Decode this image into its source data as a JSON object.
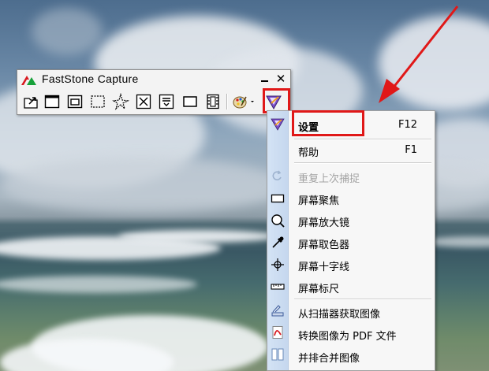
{
  "window": {
    "title": "FastStone Capture",
    "minimize_label": "",
    "close_label": "✕"
  },
  "toolbar": {
    "tools": [
      {
        "name": "open-file-icon"
      },
      {
        "name": "capture-active-window-icon"
      },
      {
        "name": "capture-window-object-icon"
      },
      {
        "name": "capture-rectangle-icon"
      },
      {
        "name": "capture-freehand-icon"
      },
      {
        "name": "capture-fullscreen-icon"
      },
      {
        "name": "capture-scrolling-window-icon"
      },
      {
        "name": "capture-fixed-region-icon"
      },
      {
        "name": "screen-recorder-icon"
      },
      {
        "name": "output-palette-icon"
      },
      {
        "name": "settings-menu-icon"
      }
    ]
  },
  "menu": {
    "items": [
      {
        "label": "设置",
        "shortcut": "F12",
        "icon": "settings-icon",
        "disabled": false
      },
      {
        "label": "帮助",
        "shortcut": "F1",
        "icon": "",
        "disabled": false
      },
      {
        "label": "重复上次捕捉",
        "shortcut": "",
        "icon": "repeat-capture-icon",
        "disabled": true
      },
      {
        "label": "屏幕聚焦",
        "shortcut": "",
        "icon": "screen-spotlight-icon",
        "disabled": false
      },
      {
        "label": "屏幕放大镜",
        "shortcut": "",
        "icon": "magnifier-icon",
        "disabled": false
      },
      {
        "label": "屏幕取色器",
        "shortcut": "",
        "icon": "color-picker-icon",
        "disabled": false
      },
      {
        "label": "屏幕十字线",
        "shortcut": "",
        "icon": "crosshair-icon",
        "disabled": false
      },
      {
        "label": "屏幕标尺",
        "shortcut": "",
        "icon": "ruler-icon",
        "disabled": false
      },
      {
        "label": "从扫描器获取图像",
        "shortcut": "",
        "icon": "scanner-icon",
        "disabled": false
      },
      {
        "label": "转换图像为 PDF 文件",
        "shortcut": "",
        "icon": "pdf-icon",
        "disabled": false
      },
      {
        "label": "并排合并图像",
        "shortcut": "",
        "icon": "combine-images-icon",
        "disabled": false
      }
    ]
  },
  "colors": {
    "highlight_box": "#e01818",
    "arrow": "#e01818",
    "menu_strip": "#c9dbf0",
    "disabled_text": "#a3a3a3"
  }
}
